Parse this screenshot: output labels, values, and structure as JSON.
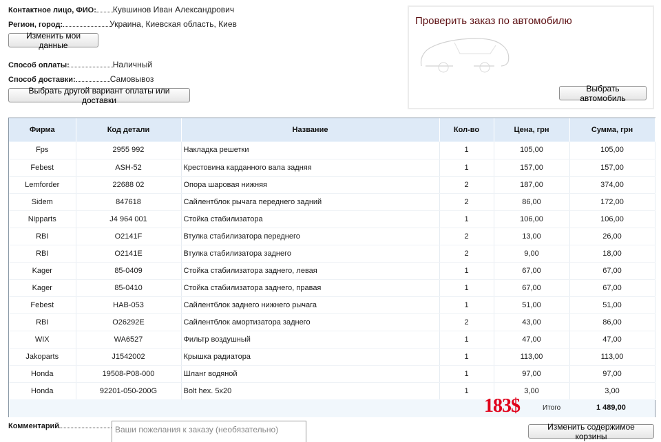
{
  "contact": {
    "fio_label": "Контактное лицо, ФИО:",
    "fio_value": "Кувшинов Иван Александрович",
    "region_label": "Регион, город:",
    "region_value": "Украина, Киевская область, Киев",
    "edit_button": "Изменить мои данные"
  },
  "payment": {
    "method_label": "Способ оплаты:",
    "method_value": "Наличный",
    "delivery_label": "Способ доставки:",
    "delivery_value": "Самовывоз",
    "change_button": "Выбрать другой вариант оплаты или доставки"
  },
  "car_panel": {
    "title": "Проверить заказ по автомобилю",
    "select_button": "Выбрать автомобиль",
    "car_icon": "car-silhouette-icon"
  },
  "table": {
    "headers": [
      "Фирма",
      "Код детали",
      "Название",
      "Кол-во",
      "Цена, грн",
      "Сумма, грн"
    ],
    "rows": [
      [
        "Fps",
        "2955 992",
        "Накладка решетки",
        "1",
        "105,00",
        "105,00"
      ],
      [
        "Febest",
        "ASH-52",
        "Крестовина карданного вала задняя",
        "1",
        "157,00",
        "157,00"
      ],
      [
        "Lemforder",
        "22688 02",
        "Опора шаровая нижняя",
        "2",
        "187,00",
        "374,00"
      ],
      [
        "Sidem",
        "847618",
        "Сайлентблок рычага переднего задний",
        "2",
        "86,00",
        "172,00"
      ],
      [
        "Nipparts",
        "J4 964 001",
        "Стойка стабилизатора",
        "1",
        "106,00",
        "106,00"
      ],
      [
        "RBI",
        "O2141F",
        "Втулка стабилизатора переднего",
        "2",
        "13,00",
        "26,00"
      ],
      [
        "RBI",
        "O2141E",
        "Втулка стабилизатора заднего",
        "2",
        "9,00",
        "18,00"
      ],
      [
        "Kager",
        "85-0409",
        "Стойка стабилизатора заднего, левая",
        "1",
        "67,00",
        "67,00"
      ],
      [
        "Kager",
        "85-0410",
        "Стойка стабилизатора заднего, правая",
        "1",
        "67,00",
        "67,00"
      ],
      [
        "Febest",
        "HAB-053",
        "Сайлентблок заднего нижнего рычага",
        "1",
        "51,00",
        "51,00"
      ],
      [
        "RBI",
        "O26292E",
        "Сайлентблок амортизатора заднего",
        "2",
        "43,00",
        "86,00"
      ],
      [
        "WIX",
        "WA6527",
        "Фильтр воздушный",
        "1",
        "47,00",
        "47,00"
      ],
      [
        "Jakoparts",
        "J1542002",
        "Крышка радиатора",
        "1",
        "113,00",
        "113,00"
      ],
      [
        "Honda",
        "19508-P08-000",
        "Шланг водяной",
        "1",
        "97,00",
        "97,00"
      ],
      [
        "Honda",
        "92201-050-200G",
        "Bolt hex. 5x20",
        "1",
        "3,00",
        "3,00"
      ]
    ],
    "total_label": "Итого",
    "total_value": "1 489,00",
    "usd_total": "183$"
  },
  "comment": {
    "label": "Комментарий",
    "placeholder": "Ваши пожелания к заказу (необязательно)"
  },
  "cart_button": "Изменить содержимое корзины",
  "colors": {
    "header_bg": "#deeaf7",
    "accent_title": "#5c0f12",
    "usd_total": "#e0001a"
  }
}
